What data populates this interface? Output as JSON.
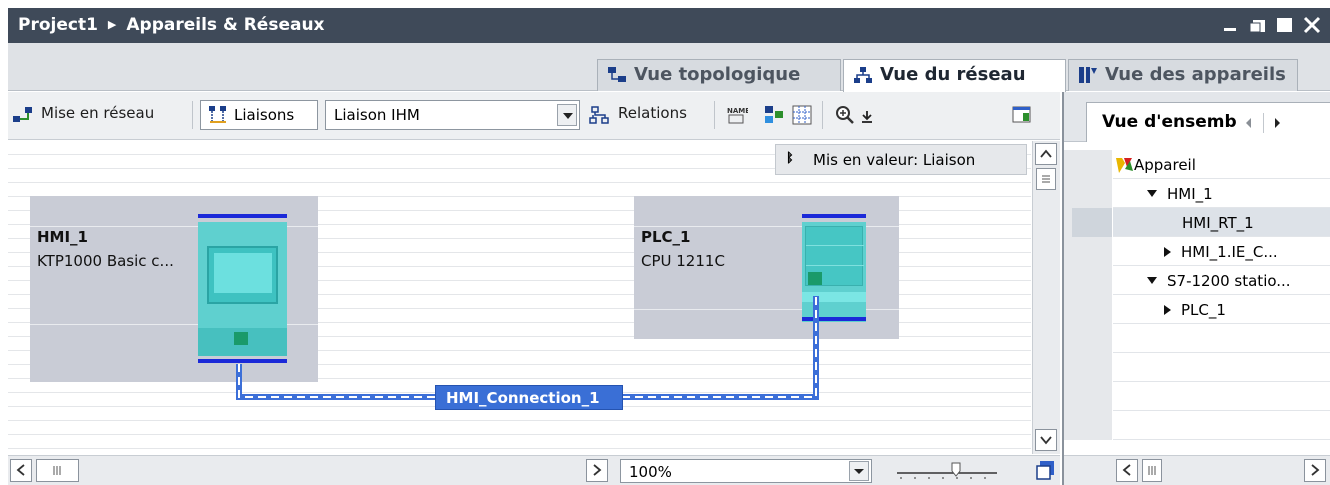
{
  "window": {
    "breadcrumb_project": "Project1",
    "breadcrumb_separator": "▶",
    "breadcrumb_page": "Appareils & Réseaux"
  },
  "view_tabs": [
    {
      "label": "Vue topologique",
      "active": false
    },
    {
      "label": "Vue du réseau",
      "active": true
    },
    {
      "label": "Vue des appareils",
      "active": false
    }
  ],
  "toolbar": {
    "network_label": "Mise en réseau",
    "connections_label": "Liaisons",
    "connection_type_value": "Liaison IHM",
    "relations_label": "Relations"
  },
  "tooltip": {
    "pin_icon": "pin-icon",
    "text": "Mis en valeur: Liaison"
  },
  "devices": [
    {
      "name": "HMI_1",
      "type": "KTP1000 Basic c..."
    },
    {
      "name": "PLC_1",
      "type": "CPU 1211C"
    }
  ],
  "connection": {
    "label": "HMI_Connection_1",
    "color": "#3c6fd8"
  },
  "bottom": {
    "zoom_value": "100%"
  },
  "overview_panel": {
    "tab_label": "Vue d'ensemble",
    "column_header": "Appareil",
    "rows": [
      {
        "label": "HMI_1",
        "expander": "down"
      },
      {
        "label": "HMI_RT_1",
        "expander": "none"
      },
      {
        "label": "HMI_1.IE_C...",
        "expander": "right"
      },
      {
        "label": "S7-1200 statio...",
        "expander": "down"
      },
      {
        "label": "PLC_1",
        "expander": "right"
      }
    ]
  },
  "colors": {
    "title_bar": "#3f4a59",
    "device_box": "#c9ccd6",
    "device_module": "#5fd0cf",
    "bus_blue": "#1b29d8",
    "connection_label_bg": "#3a6fd6"
  }
}
